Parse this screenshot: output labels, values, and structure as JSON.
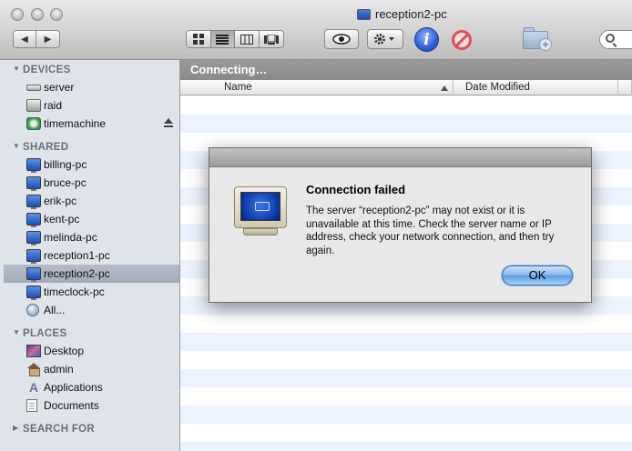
{
  "window": {
    "title": "reception2-pc"
  },
  "toolbar": {
    "back_glyph": "◀",
    "forward_glyph": "▶",
    "view_buttons": [
      "icon-view",
      "list-view",
      "column-view",
      "coverflow-view"
    ],
    "active_view": "list-view",
    "info_glyph": "i"
  },
  "sidebar": {
    "sections": [
      {
        "header": "DEVICES",
        "items": [
          {
            "label": "server",
            "icon": "drive-icon"
          },
          {
            "label": "raid",
            "icon": "raid-drive-icon"
          },
          {
            "label": "timemachine",
            "icon": "timemachine-icon",
            "eject": true
          }
        ]
      },
      {
        "header": "SHARED",
        "items": [
          {
            "label": "billing-pc",
            "icon": "pc-icon"
          },
          {
            "label": "bruce-pc",
            "icon": "pc-icon"
          },
          {
            "label": "erik-pc",
            "icon": "pc-icon"
          },
          {
            "label": "kent-pc",
            "icon": "pc-icon"
          },
          {
            "label": "melinda-pc",
            "icon": "pc-icon"
          },
          {
            "label": "reception1-pc",
            "icon": "pc-icon"
          },
          {
            "label": "reception2-pc",
            "icon": "pc-icon",
            "selected": true
          },
          {
            "label": "timeclock-pc",
            "icon": "pc-icon"
          },
          {
            "label": "All...",
            "icon": "network-globe-icon"
          }
        ]
      },
      {
        "header": "PLACES",
        "items": [
          {
            "label": "Desktop",
            "icon": "desktop-icon"
          },
          {
            "label": "admin",
            "icon": "home-icon"
          },
          {
            "label": "Applications",
            "icon": "applications-icon"
          },
          {
            "label": "Documents",
            "icon": "documents-icon"
          }
        ]
      },
      {
        "header": "SEARCH FOR",
        "collapsed": true,
        "items": []
      }
    ]
  },
  "main": {
    "status": "Connecting…",
    "columns": {
      "name": "Name",
      "date_modified": "Date Modified"
    }
  },
  "dialog": {
    "title": "Connection failed",
    "message": "The server “reception2-pc” may not exist or it is unavailable at this time. Check the server name or IP address, check your network connection, and then try again.",
    "ok_label": "OK"
  },
  "colors": {
    "sidebar_bg": "#dfe3ea",
    "selection": "#a9b1bf",
    "status_bar": "#8f8f8f",
    "row_stripe": "#edf3fe",
    "ok_button": "#6aa8eb"
  }
}
